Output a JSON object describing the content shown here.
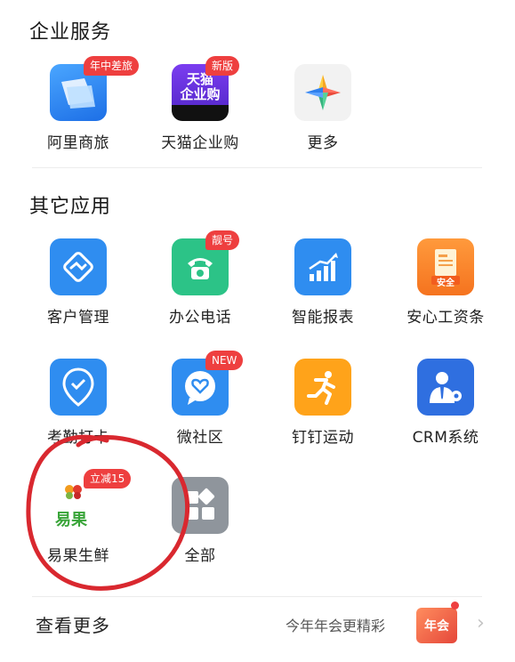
{
  "sections": {
    "enterprise": {
      "title": "企业服务"
    },
    "other": {
      "title": "其它应用"
    }
  },
  "enterprise_apps": [
    {
      "label": "阿里商旅",
      "badge": "年中差旅",
      "icon": "airplane-ticket-icon"
    },
    {
      "label": "天猫企业购",
      "badge": "新版",
      "icon": "tmall-icon",
      "icon_text": "天猫\n企业购"
    },
    {
      "label": "更多",
      "icon": "compass-star-icon"
    }
  ],
  "other_apps": [
    {
      "label": "客户管理",
      "icon": "handshake-icon"
    },
    {
      "label": "办公电话",
      "badge": "靓号",
      "icon": "phone-icon"
    },
    {
      "label": "智能报表",
      "icon": "bar-chart-icon"
    },
    {
      "label": "安心工资条",
      "icon": "payslip-icon",
      "icon_text": "安全"
    },
    {
      "label": "考勤打卡",
      "icon": "location-check-icon"
    },
    {
      "label": "微社区",
      "badge": "NEW",
      "icon": "chat-heart-icon"
    },
    {
      "label": "钉钉运动",
      "icon": "running-person-icon"
    },
    {
      "label": "CRM系统",
      "icon": "person-gear-icon"
    },
    {
      "label": "易果生鲜",
      "badge": "立减15",
      "icon": "yiguo-logo-icon",
      "icon_text": "易果"
    },
    {
      "label": "全部",
      "icon": "grid-icon"
    }
  ],
  "footer": {
    "more": "查看更多",
    "promo": "今年年会更精彩",
    "promo_icon_text": "年会"
  },
  "colors": {
    "badge": "#ee3f3f",
    "circle": "#d9282f"
  }
}
